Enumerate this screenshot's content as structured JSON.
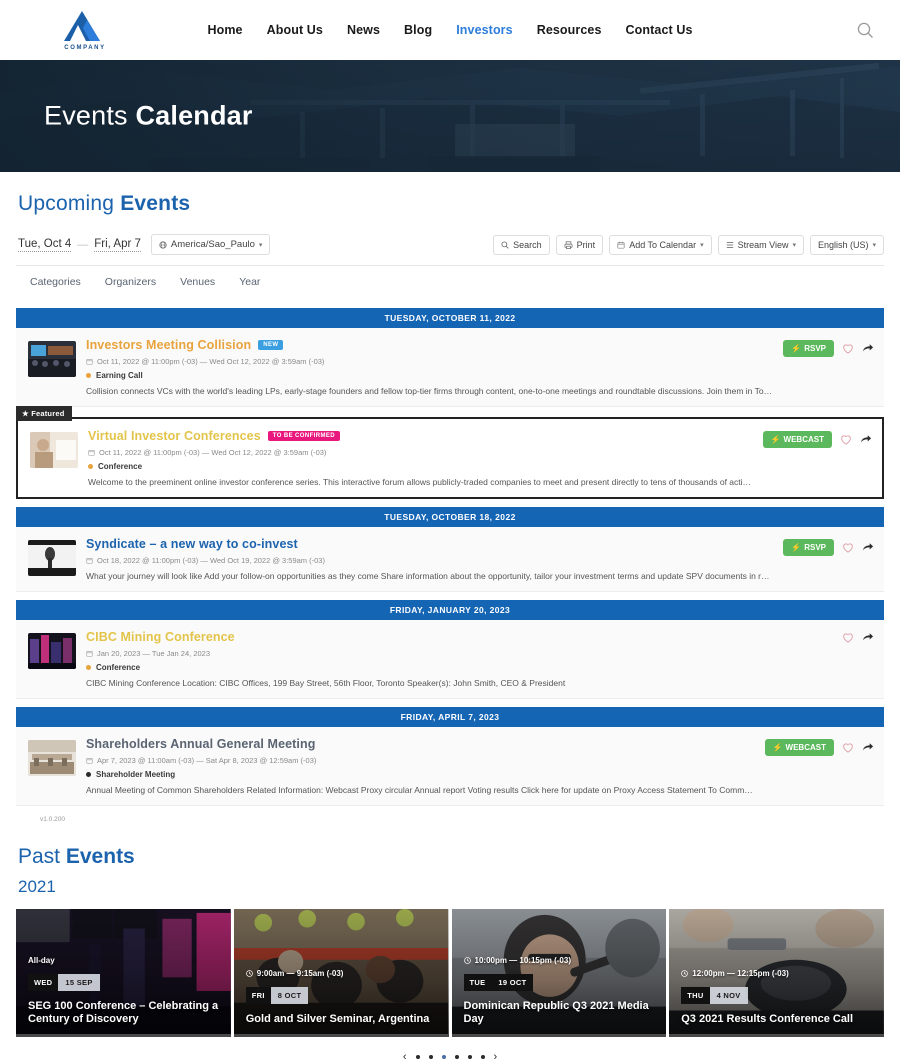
{
  "header": {
    "logo_name": "COMPANY",
    "nav": [
      {
        "label": "Home",
        "active": false
      },
      {
        "label": "About Us",
        "active": false
      },
      {
        "label": "News",
        "active": false
      },
      {
        "label": "Blog",
        "active": false
      },
      {
        "label": "Investors",
        "active": true
      },
      {
        "label": "Resources",
        "active": false
      },
      {
        "label": "Contact Us",
        "active": false
      }
    ],
    "search_icon": "search-icon"
  },
  "hero": {
    "title_light": "Events",
    "title_bold": "Calendar"
  },
  "upcoming": {
    "title_light": "Upcoming",
    "title_bold": "Events",
    "date_start": "Tue, Oct 4",
    "date_separator": "—",
    "date_end": "Fri, Apr 7",
    "timezone": "America/Sao_Paulo",
    "toolbar": [
      {
        "label": "Search",
        "icon": "search-icon",
        "caret": false
      },
      {
        "label": "Print",
        "icon": "printer-icon",
        "caret": false
      },
      {
        "label": "Add To Calendar",
        "icon": "calendar-icon",
        "caret": true
      },
      {
        "label": "Stream View",
        "icon": "list-icon",
        "caret": true
      },
      {
        "label": "English (US)",
        "icon": "",
        "caret": true
      }
    ],
    "sub_filters": [
      "Categories",
      "Organizers",
      "Venues",
      "Year"
    ],
    "version": "v1.0.200"
  },
  "groups": [
    {
      "day_header": "TUESDAY, OCTOBER 11, 2022",
      "events": [
        {
          "title": "Investors Meeting Collision",
          "title_color": "orange",
          "badge": "NEW",
          "badge_type": "new",
          "featured": false,
          "featured_label": "",
          "date": "Oct 11, 2022 @ 11:00pm (-03) — Wed Oct 12, 2022 @ 3:59am (-03)",
          "category": "Earning Call",
          "category_color": "#e8a33d",
          "description": "Collision connects VCs with the world's leading LPs, early-stage founders and fellow top-tier firms through content, one-to-one meetings and roundtable discussions. Join them in Toronto this June.",
          "action_label": "RSVP",
          "action_type": "rsvp"
        },
        {
          "title": "Virtual Investor Conferences",
          "title_color": "gold",
          "badge": "TO BE CONFIRMED",
          "badge_type": "tbc",
          "featured": true,
          "featured_label": "★ Featured",
          "date": "Oct 11, 2022 @ 11:00pm (-03) — Wed Oct 12, 2022 @ 3:59am (-03)",
          "category": "Conference",
          "category_color": "#e8a33d",
          "description": "Welcome to the preeminent online investor conference series. This interactive forum allows publicly-traded companies to meet and present directly to tens of thousands of active investors – all without...",
          "action_label": "WEBCAST",
          "action_type": "webcast"
        }
      ]
    },
    {
      "day_header": "TUESDAY, OCTOBER 18, 2022",
      "events": [
        {
          "title": "Syndicate – a new way to co-invest",
          "title_color": "blue",
          "badge": "",
          "badge_type": "",
          "featured": false,
          "featured_label": "",
          "date": "Oct 18, 2022 @ 11:00pm (-03) — Wed Oct 19, 2022 @ 3:59am (-03)",
          "category": "",
          "category_color": "",
          "description": "What your journey will look like Add your follow-on opportunities as they come Share information about the opportunity, tailor your investment terms and update SPV documents in real time. Push the o...",
          "action_label": "RSVP",
          "action_type": "rsvp"
        }
      ]
    },
    {
      "day_header": "FRIDAY, JANUARY 20, 2023",
      "events": [
        {
          "title": "CIBC Mining Conference",
          "title_color": "gold",
          "badge": "",
          "badge_type": "",
          "featured": false,
          "featured_label": "",
          "date": "Jan 20, 2023 — Tue Jan 24, 2023",
          "category": "Conference",
          "category_color": "#e8a33d",
          "description": "CIBC Mining Conference Location: CIBC Offices, 199 Bay Street, 56th Floor, Toronto Speaker(s): John Smith, CEO & President",
          "action_label": "",
          "action_type": "none"
        }
      ]
    },
    {
      "day_header": "FRIDAY, APRIL 7, 2023",
      "events": [
        {
          "title": "Shareholders Annual General Meeting",
          "title_color": "grey",
          "badge": "",
          "badge_type": "",
          "featured": false,
          "featured_label": "",
          "date": "Apr 7, 2023 @ 11:00am (-03) — Sat Apr 8, 2023 @ 12:59am (-03)",
          "category": "Shareholder Meeting",
          "category_color": "#2b2b2b",
          "description": "Annual Meeting of Common Shareholders Related Information: Webcast Proxy circular Annual report Voting results Click here for update on Proxy Access Statement To Communicate with Independent Direct...",
          "action_label": "WEBCAST",
          "action_type": "webcast"
        }
      ]
    }
  ],
  "past": {
    "title_light": "Past",
    "title_bold": "Events",
    "year": "2021",
    "cards": [
      {
        "time": "All-day",
        "has_clock": false,
        "dow": "WED",
        "day_month": "15 SEP",
        "date_dark": false,
        "title": "SEG 100 Conference – Celebrating a Century of Discovery"
      },
      {
        "time": "9:00am — 9:15am (-03)",
        "has_clock": true,
        "dow": "FRI",
        "day_month": "8 OCT",
        "date_dark": false,
        "title": "Gold and Silver Seminar, Argentina"
      },
      {
        "time": "10:00pm — 10:15pm (-03)",
        "has_clock": true,
        "dow": "TUE",
        "day_month": "19 OCT",
        "date_dark": true,
        "title": "Dominican Republic Q3 2021 Media Day"
      },
      {
        "time": "12:00pm — 12:15pm (-03)",
        "has_clock": true,
        "dow": "THU",
        "day_month": "4 NOV",
        "date_dark": false,
        "title": "Q3 2021 Results Conference Call"
      }
    ],
    "pager": {
      "prev": "‹",
      "next": "›",
      "dot_count": 6,
      "active_dot": 2
    }
  },
  "colors": {
    "brand_blue": "#1b63ad",
    "day_header_blue": "#1565b5",
    "rsvp_green": "#5cb85c",
    "badge_new": "#3a9fe0",
    "badge_tbc": "#e8187e",
    "title_orange": "#e8a33d"
  }
}
